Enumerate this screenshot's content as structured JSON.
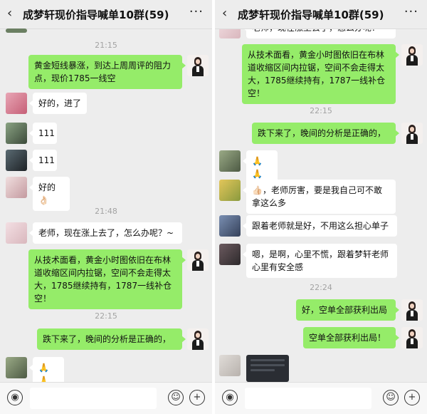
{
  "colors": {
    "my_bubble": "#95ec69",
    "their_bubble": "#ffffff",
    "bg": "#ededed",
    "timestamp": "#a3a3a3"
  },
  "left": {
    "header": {
      "back_icon": "‹",
      "title": "成梦轩现价指导喊单10群(59)",
      "more_icon": "···"
    },
    "t1": "21:15",
    "m1": "黄金短线暴涨，到达上周周评的阻力点，现价1785一线空",
    "m2": "好的，进了",
    "m3": "111",
    "m4": "111",
    "m5": "好的👌🏻",
    "t2": "21:48",
    "m6": "老师，现在涨上去了，怎么办呢？~",
    "m7": "从技术面看，黄金小时图依旧在布林道收缩区间内拉锯，空间不会走得太大，1785继续持有，1787一线补仓空！",
    "t3": "22:15",
    "m8": "跌下来了，晚间的分析是正确的，",
    "m9": "🙏🙏"
  },
  "right": {
    "header": {
      "back_icon": "‹",
      "title": "成梦轩现价指导喊单10群(59)",
      "more_icon": "···"
    },
    "m0": "老师，现在涨上去了，怎么办呢？~",
    "m1": "从技术面看，黄金小时图依旧在布林道收缩区间内拉锯，空间不会走得太大，1785继续持有，1787一线补仓空！",
    "t1": "22:15",
    "m2": "跌下来了，晚间的分析是正确的，",
    "m3": "🙏🙏",
    "m4": "👍🏻，老师厉害，要是我自己可不敢拿这么多",
    "m5": "跟着老师就是好，不用这么担心单子",
    "m6": "嗯，是啊，心里不慌，跟着梦轩老师心里有安全感",
    "t2": "22:24",
    "m7": "好，空单全部获利出局",
    "m8": "空单全部获利出局！"
  },
  "footer": {
    "voice_icon": "voice-icon",
    "emoji_icon": "emoji-icon",
    "plus_icon": "plus-icon"
  }
}
